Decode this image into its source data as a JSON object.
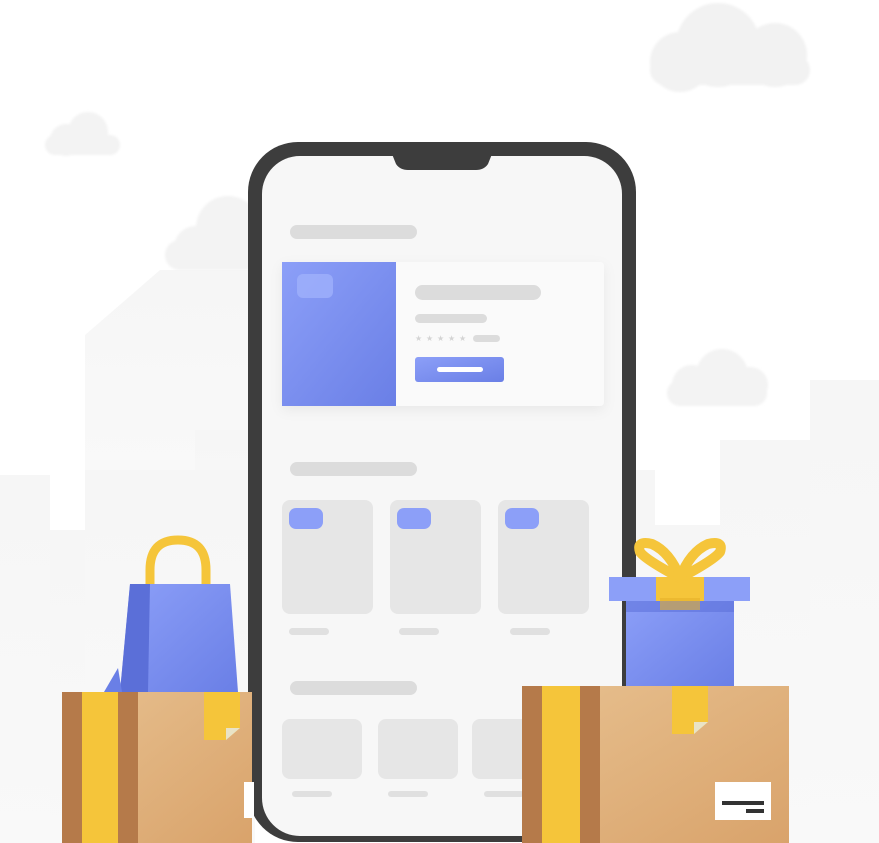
{
  "illustration": {
    "subject": "mobile-shopping",
    "colors": {
      "background": "#ffffff",
      "city": "#f4f4f4",
      "cloud": "#f2f2f2",
      "phone_frame": "#3d3d3d",
      "screen": "#f7f7f7",
      "placeholder": "#dcdcdc",
      "placeholder_light": "#e6e6e6",
      "accent_blue": "#7f93f5",
      "accent_blue_dark": "#5b6fd8",
      "gold": "#f5c53a",
      "cardboard": "#e2b07c",
      "cardboard_dark": "#b57a4a"
    },
    "phone": {
      "featured_product": {
        "rating_stars": 5
      },
      "product_grid_cards": 3,
      "bottom_row_cards": 3
    },
    "props": [
      "shopping-bag",
      "gift-box",
      "cardboard-box",
      "cardboard-box"
    ]
  }
}
